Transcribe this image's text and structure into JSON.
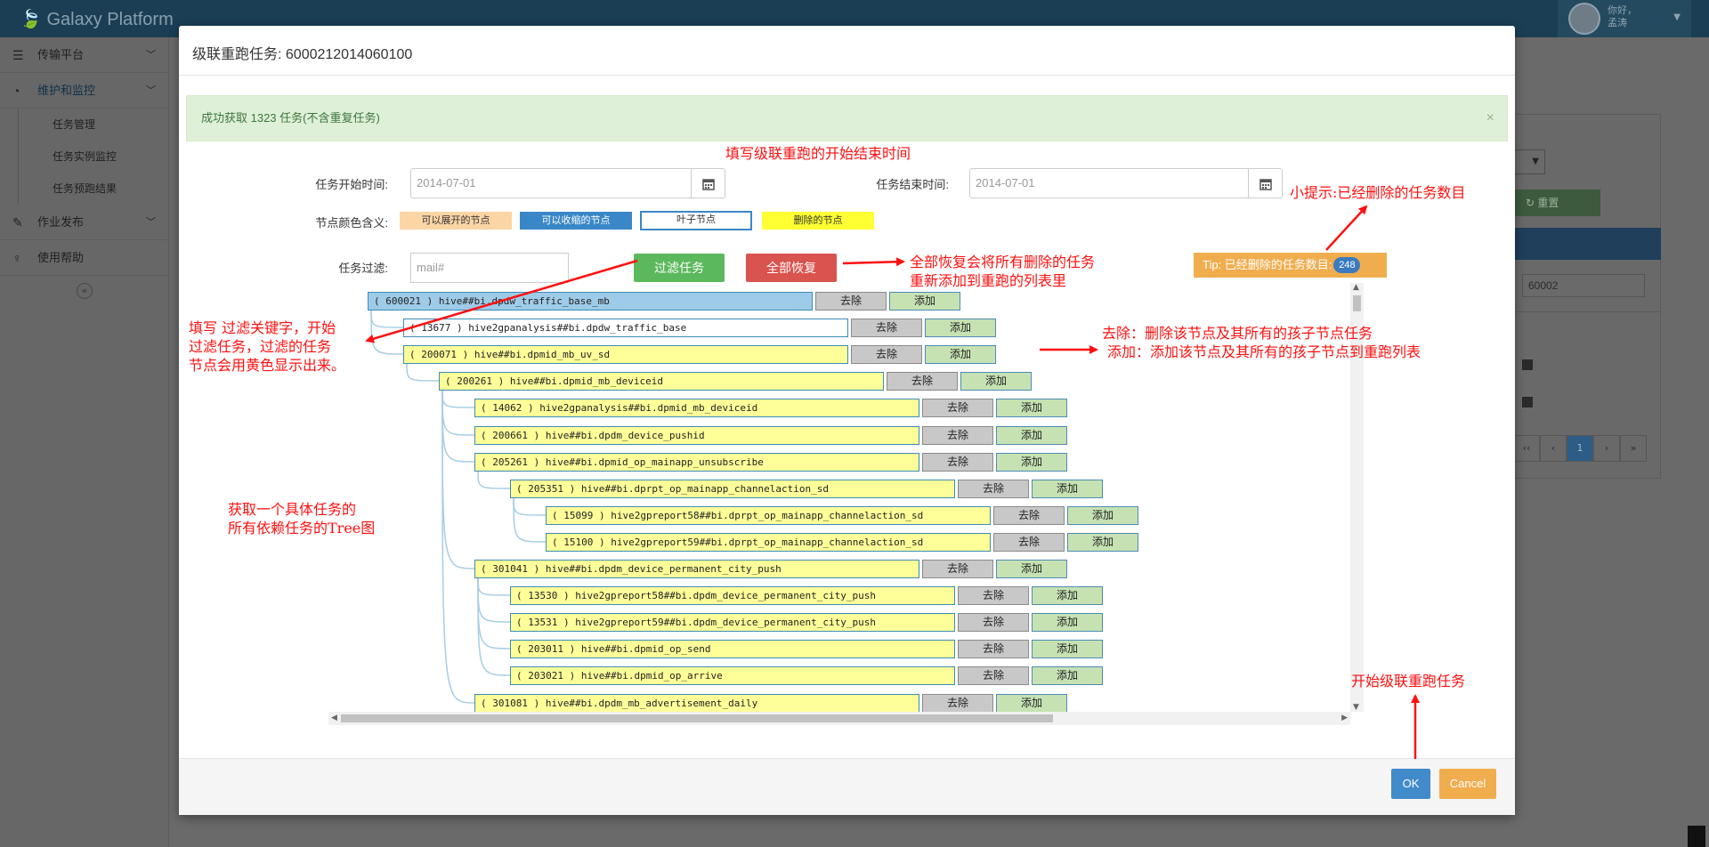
{
  "app": {
    "brand": "Galaxy Platform",
    "user_line1": "你好，",
    "user_line2": "孟涛"
  },
  "sidebar": {
    "items": [
      {
        "label": "传输平台",
        "icon": "list-icon"
      },
      {
        "label": "维护和监控",
        "icon": "dashboard-icon"
      },
      {
        "label": "作业发布",
        "icon": "brush-icon"
      },
      {
        "label": "使用帮助",
        "icon": "lightbulb-icon"
      }
    ],
    "subitems": [
      "任务管理",
      "任务实例监控",
      "任务预跑结果"
    ],
    "collapse": "«"
  },
  "background": {
    "reset_label": "↻ 重置",
    "input_value": "60002",
    "pager": [
      "‹‹",
      "‹",
      "1",
      "›",
      "»"
    ]
  },
  "modal": {
    "title": "级联重跑任务: 6000212014060100",
    "alert": "成功获取 1323 任务(不含重复任务)",
    "alert_close": "×",
    "start_label": "任务开始时间:",
    "start_value": "2014-07-01",
    "end_label": "任务结束时间:",
    "end_value": "2014-07-01",
    "legend_label": "节点颜色含义:",
    "legend": [
      {
        "label": "可以展开的节点",
        "color": "#fcd5a5"
      },
      {
        "label": "可以收缩的节点",
        "color": "#3a87c8"
      },
      {
        "label": "叶子节点",
        "color": "#ffffff"
      },
      {
        "label": "删除的节点",
        "color": "#ffff33"
      }
    ],
    "filter_label": "任务过滤:",
    "filter_placeholder": "mail#",
    "filter_button": "过滤任务",
    "restore_button": "全部恢复",
    "tip_text": "Tip: 已经删除的任务数目:",
    "tip_count": "248",
    "delete_label": "去除",
    "add_label": "添加",
    "ok_label": "OK",
    "cancel_label": "Cancel"
  },
  "tree": {
    "nodes": [
      {
        "text": "( 600021 ) hive##bi.dpdw_traffic_base_mb",
        "level": 0,
        "style": "root"
      },
      {
        "text": "( 13677 ) hive2gpanalysis##bi.dpdw_traffic_base",
        "level": 1,
        "style": "plain"
      },
      {
        "text": "( 200071 ) hive##bi.dpmid_mb_uv_sd",
        "level": 1,
        "style": "hl"
      },
      {
        "text": "( 200261 ) hive##bi.dpmid_mb_deviceid",
        "level": 2,
        "style": "hl"
      },
      {
        "text": "( 14062 ) hive2gpanalysis##bi.dpmid_mb_deviceid",
        "level": 3,
        "style": "hl"
      },
      {
        "text": "( 200661 ) hive##bi.dpdm_device_pushid",
        "level": 3,
        "style": "hl"
      },
      {
        "text": "( 205261 ) hive##bi.dpmid_op_mainapp_unsubscribe",
        "level": 3,
        "style": "hl"
      },
      {
        "text": "( 205351 ) hive##bi.dprpt_op_mainapp_channelaction_sd",
        "level": 4,
        "style": "hl"
      },
      {
        "text": "( 15099 ) hive2gpreport58##bi.dprpt_op_mainapp_channelaction_sd",
        "level": 5,
        "style": "hl"
      },
      {
        "text": "( 15100 ) hive2gpreport59##bi.dprpt_op_mainapp_channelaction_sd",
        "level": 5,
        "style": "hl"
      },
      {
        "text": "( 301041 ) hive##bi.dpdm_device_permanent_city_push",
        "level": 3,
        "style": "hl"
      },
      {
        "text": "( 13530 ) hive2gpreport58##bi.dpdm_device_permanent_city_push",
        "level": 4,
        "style": "hl"
      },
      {
        "text": "( 13531 ) hive2gpreport59##bi.dpdm_device_permanent_city_push",
        "level": 4,
        "style": "hl"
      },
      {
        "text": "( 203011 ) hive##bi.dpmid_op_send",
        "level": 4,
        "style": "hl"
      },
      {
        "text": "( 203021 ) hive##bi.dpmid_op_arrive",
        "level": 4,
        "style": "hl"
      },
      {
        "text": "( 301081 ) hive##bi.dpdm_mb_advertisement_daily",
        "level": 3,
        "style": "hl"
      }
    ]
  },
  "annotations": {
    "top": "填写级联重跑的开始结束时间",
    "tip": "小提示:已经删除的任务数目",
    "restore": [
      "全部恢复会将所有删除的任务",
      "重新添加到重跑的列表里"
    ],
    "filter": [
      "填写  过滤关键字，开始",
      "过滤任务，过滤的任务",
      "节点会用黄色显示出来。"
    ],
    "tree": [
      "获取一个具体任务的",
      "所有依赖任务的Tree图"
    ],
    "buttons": [
      "去除：删除该节点及其所有的孩子节点任务",
      "添加：添加该节点及其所有的孩子节点到重跑列表"
    ],
    "start": "开始级联重跑任务"
  }
}
